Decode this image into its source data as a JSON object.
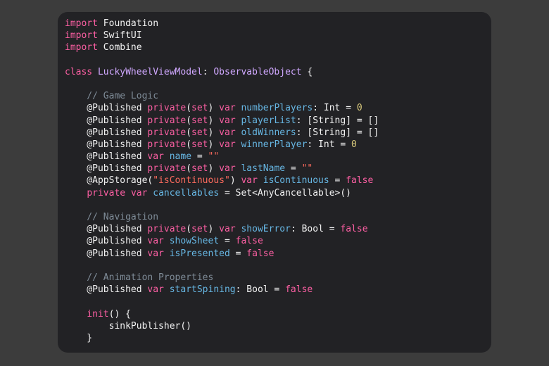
{
  "colors": {
    "background": "#3c3c3c",
    "editor_background": "#222225",
    "keyword": "#fc5fa3",
    "comment": "#7f8c98",
    "type": "#d0a8ff",
    "plain": "#f2f2f2",
    "property": "#67b7e4",
    "number": "#d9c97c",
    "string": "#fc6a5d"
  },
  "code": {
    "language": "Swift",
    "lines": [
      [
        {
          "t": "import",
          "c": "keyword"
        },
        {
          "t": " Foundation",
          "c": "plain"
        }
      ],
      [
        {
          "t": "import",
          "c": "keyword"
        },
        {
          "t": " SwiftUI",
          "c": "plain"
        }
      ],
      [
        {
          "t": "import",
          "c": "keyword"
        },
        {
          "t": " Combine",
          "c": "plain"
        }
      ],
      [],
      [
        {
          "t": "class",
          "c": "keyword"
        },
        {
          "t": " ",
          "c": "plain"
        },
        {
          "t": "LuckyWheelViewModel",
          "c": "type"
        },
        {
          "t": ": ",
          "c": "plain"
        },
        {
          "t": "ObservableObject",
          "c": "type"
        },
        {
          "t": " {",
          "c": "plain"
        }
      ],
      [],
      [
        {
          "t": "    // Game Logic",
          "c": "comment"
        }
      ],
      [
        {
          "t": "    @Published ",
          "c": "plain"
        },
        {
          "t": "private",
          "c": "keyword"
        },
        {
          "t": "(",
          "c": "plain"
        },
        {
          "t": "set",
          "c": "keyword"
        },
        {
          "t": ") ",
          "c": "plain"
        },
        {
          "t": "var",
          "c": "keyword"
        },
        {
          "t": " ",
          "c": "plain"
        },
        {
          "t": "numberPlayers",
          "c": "property"
        },
        {
          "t": ": Int = ",
          "c": "plain"
        },
        {
          "t": "0",
          "c": "number"
        }
      ],
      [
        {
          "t": "    @Published ",
          "c": "plain"
        },
        {
          "t": "private",
          "c": "keyword"
        },
        {
          "t": "(",
          "c": "plain"
        },
        {
          "t": "set",
          "c": "keyword"
        },
        {
          "t": ") ",
          "c": "plain"
        },
        {
          "t": "var",
          "c": "keyword"
        },
        {
          "t": " ",
          "c": "plain"
        },
        {
          "t": "playerList",
          "c": "property"
        },
        {
          "t": ": [String] = []",
          "c": "plain"
        }
      ],
      [
        {
          "t": "    @Published ",
          "c": "plain"
        },
        {
          "t": "private",
          "c": "keyword"
        },
        {
          "t": "(",
          "c": "plain"
        },
        {
          "t": "set",
          "c": "keyword"
        },
        {
          "t": ") ",
          "c": "plain"
        },
        {
          "t": "var",
          "c": "keyword"
        },
        {
          "t": " ",
          "c": "plain"
        },
        {
          "t": "oldWinners",
          "c": "property"
        },
        {
          "t": ": [String] = []",
          "c": "plain"
        }
      ],
      [
        {
          "t": "    @Published ",
          "c": "plain"
        },
        {
          "t": "private",
          "c": "keyword"
        },
        {
          "t": "(",
          "c": "plain"
        },
        {
          "t": "set",
          "c": "keyword"
        },
        {
          "t": ") ",
          "c": "plain"
        },
        {
          "t": "var",
          "c": "keyword"
        },
        {
          "t": " ",
          "c": "plain"
        },
        {
          "t": "winnerPlayer",
          "c": "property"
        },
        {
          "t": ": Int = ",
          "c": "plain"
        },
        {
          "t": "0",
          "c": "number"
        }
      ],
      [
        {
          "t": "    @Published ",
          "c": "plain"
        },
        {
          "t": "var",
          "c": "keyword"
        },
        {
          "t": " ",
          "c": "plain"
        },
        {
          "t": "name",
          "c": "property"
        },
        {
          "t": " = ",
          "c": "plain"
        },
        {
          "t": "\"\"",
          "c": "string"
        }
      ],
      [
        {
          "t": "    @Published ",
          "c": "plain"
        },
        {
          "t": "private",
          "c": "keyword"
        },
        {
          "t": "(",
          "c": "plain"
        },
        {
          "t": "set",
          "c": "keyword"
        },
        {
          "t": ") ",
          "c": "plain"
        },
        {
          "t": "var",
          "c": "keyword"
        },
        {
          "t": " ",
          "c": "plain"
        },
        {
          "t": "lastName",
          "c": "property"
        },
        {
          "t": " = ",
          "c": "plain"
        },
        {
          "t": "\"\"",
          "c": "string"
        }
      ],
      [
        {
          "t": "    @AppStorage(",
          "c": "plain"
        },
        {
          "t": "\"isContinuous\"",
          "c": "string"
        },
        {
          "t": ") ",
          "c": "plain"
        },
        {
          "t": "var",
          "c": "keyword"
        },
        {
          "t": " ",
          "c": "plain"
        },
        {
          "t": "isContinuous",
          "c": "property"
        },
        {
          "t": " = ",
          "c": "plain"
        },
        {
          "t": "false",
          "c": "keyword"
        }
      ],
      [
        {
          "t": "    ",
          "c": "plain"
        },
        {
          "t": "private",
          "c": "keyword"
        },
        {
          "t": " ",
          "c": "plain"
        },
        {
          "t": "var",
          "c": "keyword"
        },
        {
          "t": " ",
          "c": "plain"
        },
        {
          "t": "cancellables",
          "c": "property"
        },
        {
          "t": " = Set<AnyCancellable>()",
          "c": "plain"
        }
      ],
      [],
      [
        {
          "t": "    // Navigation",
          "c": "comment"
        }
      ],
      [
        {
          "t": "    @Published ",
          "c": "plain"
        },
        {
          "t": "private",
          "c": "keyword"
        },
        {
          "t": "(",
          "c": "plain"
        },
        {
          "t": "set",
          "c": "keyword"
        },
        {
          "t": ") ",
          "c": "plain"
        },
        {
          "t": "var",
          "c": "keyword"
        },
        {
          "t": " ",
          "c": "plain"
        },
        {
          "t": "showError",
          "c": "property"
        },
        {
          "t": ": Bool = ",
          "c": "plain"
        },
        {
          "t": "false",
          "c": "keyword"
        }
      ],
      [
        {
          "t": "    @Published ",
          "c": "plain"
        },
        {
          "t": "var",
          "c": "keyword"
        },
        {
          "t": " ",
          "c": "plain"
        },
        {
          "t": "showSheet",
          "c": "property"
        },
        {
          "t": " = ",
          "c": "plain"
        },
        {
          "t": "false",
          "c": "keyword"
        }
      ],
      [
        {
          "t": "    @Published ",
          "c": "plain"
        },
        {
          "t": "var",
          "c": "keyword"
        },
        {
          "t": " ",
          "c": "plain"
        },
        {
          "t": "isPresented",
          "c": "property"
        },
        {
          "t": " = ",
          "c": "plain"
        },
        {
          "t": "false",
          "c": "keyword"
        }
      ],
      [],
      [
        {
          "t": "    // Animation Properties",
          "c": "comment"
        }
      ],
      [
        {
          "t": "    @Published ",
          "c": "plain"
        },
        {
          "t": "var",
          "c": "keyword"
        },
        {
          "t": " ",
          "c": "plain"
        },
        {
          "t": "startSpining",
          "c": "property"
        },
        {
          "t": ": Bool = ",
          "c": "plain"
        },
        {
          "t": "false",
          "c": "keyword"
        }
      ],
      [],
      [
        {
          "t": "    ",
          "c": "plain"
        },
        {
          "t": "init",
          "c": "keyword"
        },
        {
          "t": "() {",
          "c": "plain"
        }
      ],
      [
        {
          "t": "        sinkPublisher()",
          "c": "plain"
        }
      ],
      [
        {
          "t": "    }",
          "c": "plain"
        }
      ]
    ]
  }
}
